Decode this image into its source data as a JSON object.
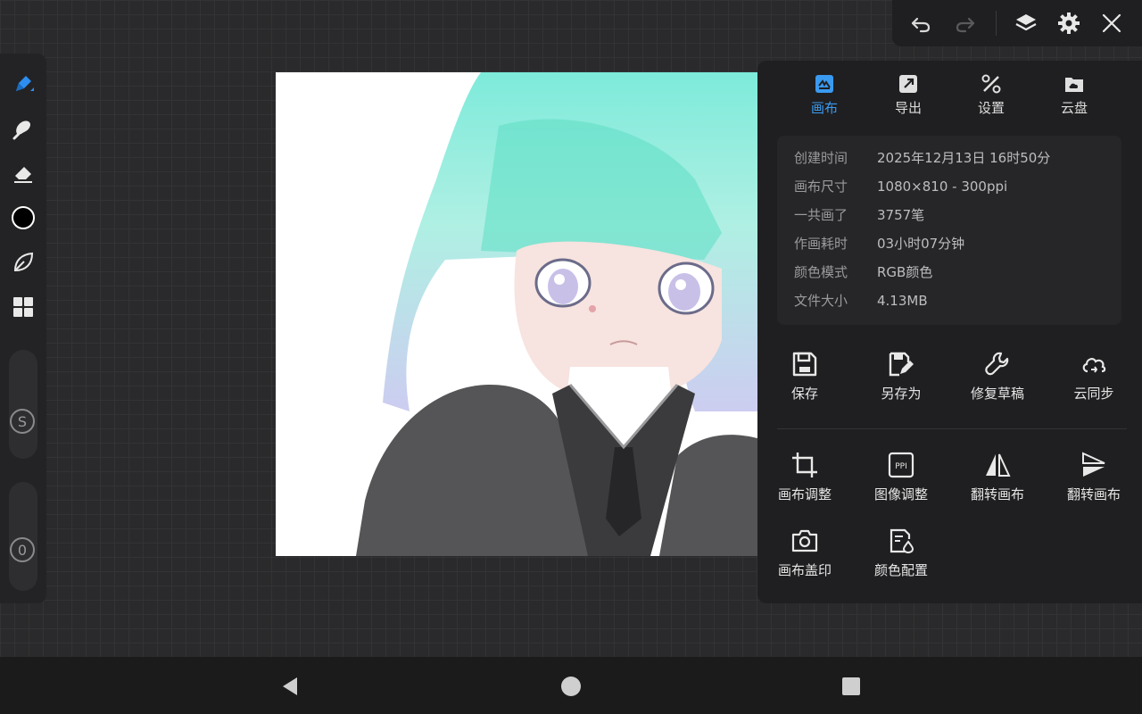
{
  "panel": {
    "tabs": [
      {
        "label": "画布",
        "icon": "canvas-icon",
        "active": true
      },
      {
        "label": "导出",
        "icon": "export-icon",
        "active": false
      },
      {
        "label": "设置",
        "icon": "settings-icon",
        "active": false
      },
      {
        "label": "云盘",
        "icon": "cloud-drive-icon",
        "active": false
      }
    ],
    "info": [
      {
        "key": "创建时间",
        "value": "2025年12月13日 16时50分"
      },
      {
        "key": "画布尺寸",
        "value": "1080×810 - 300ppi"
      },
      {
        "key": "一共画了",
        "value": "3757笔"
      },
      {
        "key": "作画耗时",
        "value": "03小时07分钟"
      },
      {
        "key": "颜色模式",
        "value": "RGB颜色"
      },
      {
        "key": "文件大小",
        "value": "4.13MB"
      }
    ],
    "actions": [
      {
        "label": "保存",
        "icon": "save-icon"
      },
      {
        "label": "另存为",
        "icon": "save-as-icon"
      },
      {
        "label": "修复草稿",
        "icon": "repair-wrench-icon"
      },
      {
        "label": "云同步",
        "icon": "cloud-sync-icon"
      },
      {
        "label": "画布调整",
        "icon": "crop-icon"
      },
      {
        "label": "图像调整",
        "icon": "ppi-icon"
      },
      {
        "label": "翻转画布",
        "icon": "flip-horizontal-icon"
      },
      {
        "label": "翻转画布",
        "icon": "flip-vertical-icon"
      },
      {
        "label": "画布盖印",
        "icon": "camera-stamp-icon"
      },
      {
        "label": "颜色配置",
        "icon": "color-profile-icon"
      }
    ],
    "accent_color": "#3a9af0"
  },
  "left_toolbar": {
    "tools": [
      "pen-icon",
      "smudge-icon",
      "eraser-icon",
      "color-swatch",
      "leaf-icon",
      "grid-icon"
    ],
    "current_color": "#000000",
    "size_slider_label": "S",
    "opacity_slider_label": "0"
  },
  "top_toolbar": {
    "buttons": [
      "undo-icon",
      "redo-icon",
      "layers-icon",
      "gear-icon",
      "close-icon"
    ]
  },
  "nav_bar": {
    "buttons": [
      "back-icon",
      "home-icon",
      "recents-icon"
    ]
  }
}
